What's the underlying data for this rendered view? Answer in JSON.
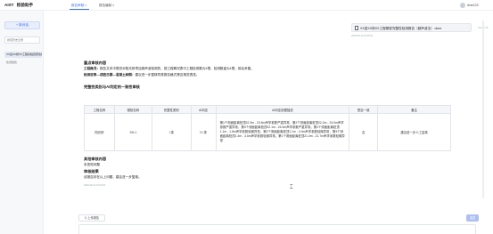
{
  "app": {
    "title": "AIST",
    "subtitle": "检验助手"
  },
  "tabs": [
    {
      "label": "报告审核",
      "active": true
    },
    {
      "label": "报告编制",
      "active": false
    }
  ],
  "user": {
    "name": "lime123"
  },
  "sidebar": {
    "new_chat_label": "+ 新对话",
    "search_placeholder": "搜索历史记录",
    "session_label": "XX县XX桥XX工程基桩完整性检测报告...",
    "sub_item_label": "检测报告"
  },
  "user_message": {
    "file_name": "XX县XX桥XX工程基桩完整性检测报告（超声波法）.docx",
    "time": "time12:15",
    "sub_time": "2025-08-13 15:06:00"
  },
  "answer": {
    "section1_title": "重点审核内容",
    "section1_line1_label": "工程概况：",
    "section1_line1_text": "报告文本中提供对阳光桥项目超声波检测的，按工程概况表中工程检测数为1根，检测数量为1根，前后矛盾。",
    "section1_line2_label": "检测目录—成桩日期—混凝土龄期：",
    "section1_line2_text": "建议进一步复核同类报告格式是否规范表述。",
    "section2_title": "完整性类别与AI判定的一致性审核",
    "table": {
      "headers": [
        "工程名称",
        "基桩名称",
        "完整性类别",
        "AI判定",
        "AI判定依据描述",
        "是否一致",
        "备注"
      ],
      "rows": [
        [
          "阳光桥",
          "SH-1",
          "I 类",
          "IV 类",
          "第1个测面距离桩顶22.3m - 23.6m声学参数严重异常，第2个测面距离桩顶22.2m - 24.0m声学参数严重异常，第3个测面距离桩顶22.1m - 24.0m声学参数严重异常。第1个测面距离桩顶1.1m - 1.8m声学参数轻微异常，第2个测面距离桩顶1.1m - 4.0m声学参数轻微异常，第3个测面距离桩顶1.3m - 3.6m声学参数轻微异常。第1个测面距离桩顶21.4m - 21.7m声学参数轻微异常",
          "否",
          "建议进一步人工复核"
        ]
      ]
    },
    "section3_title": "其他审核内容",
    "section3_text": "未发现问题",
    "section4_title": "审核结果",
    "section4_text": "该报告存在以上问题，建议进一步复核。",
    "time": "2025-08-13 15:06:00"
  },
  "composer": {
    "upload_label": "上传报告",
    "send_label": "发送"
  }
}
